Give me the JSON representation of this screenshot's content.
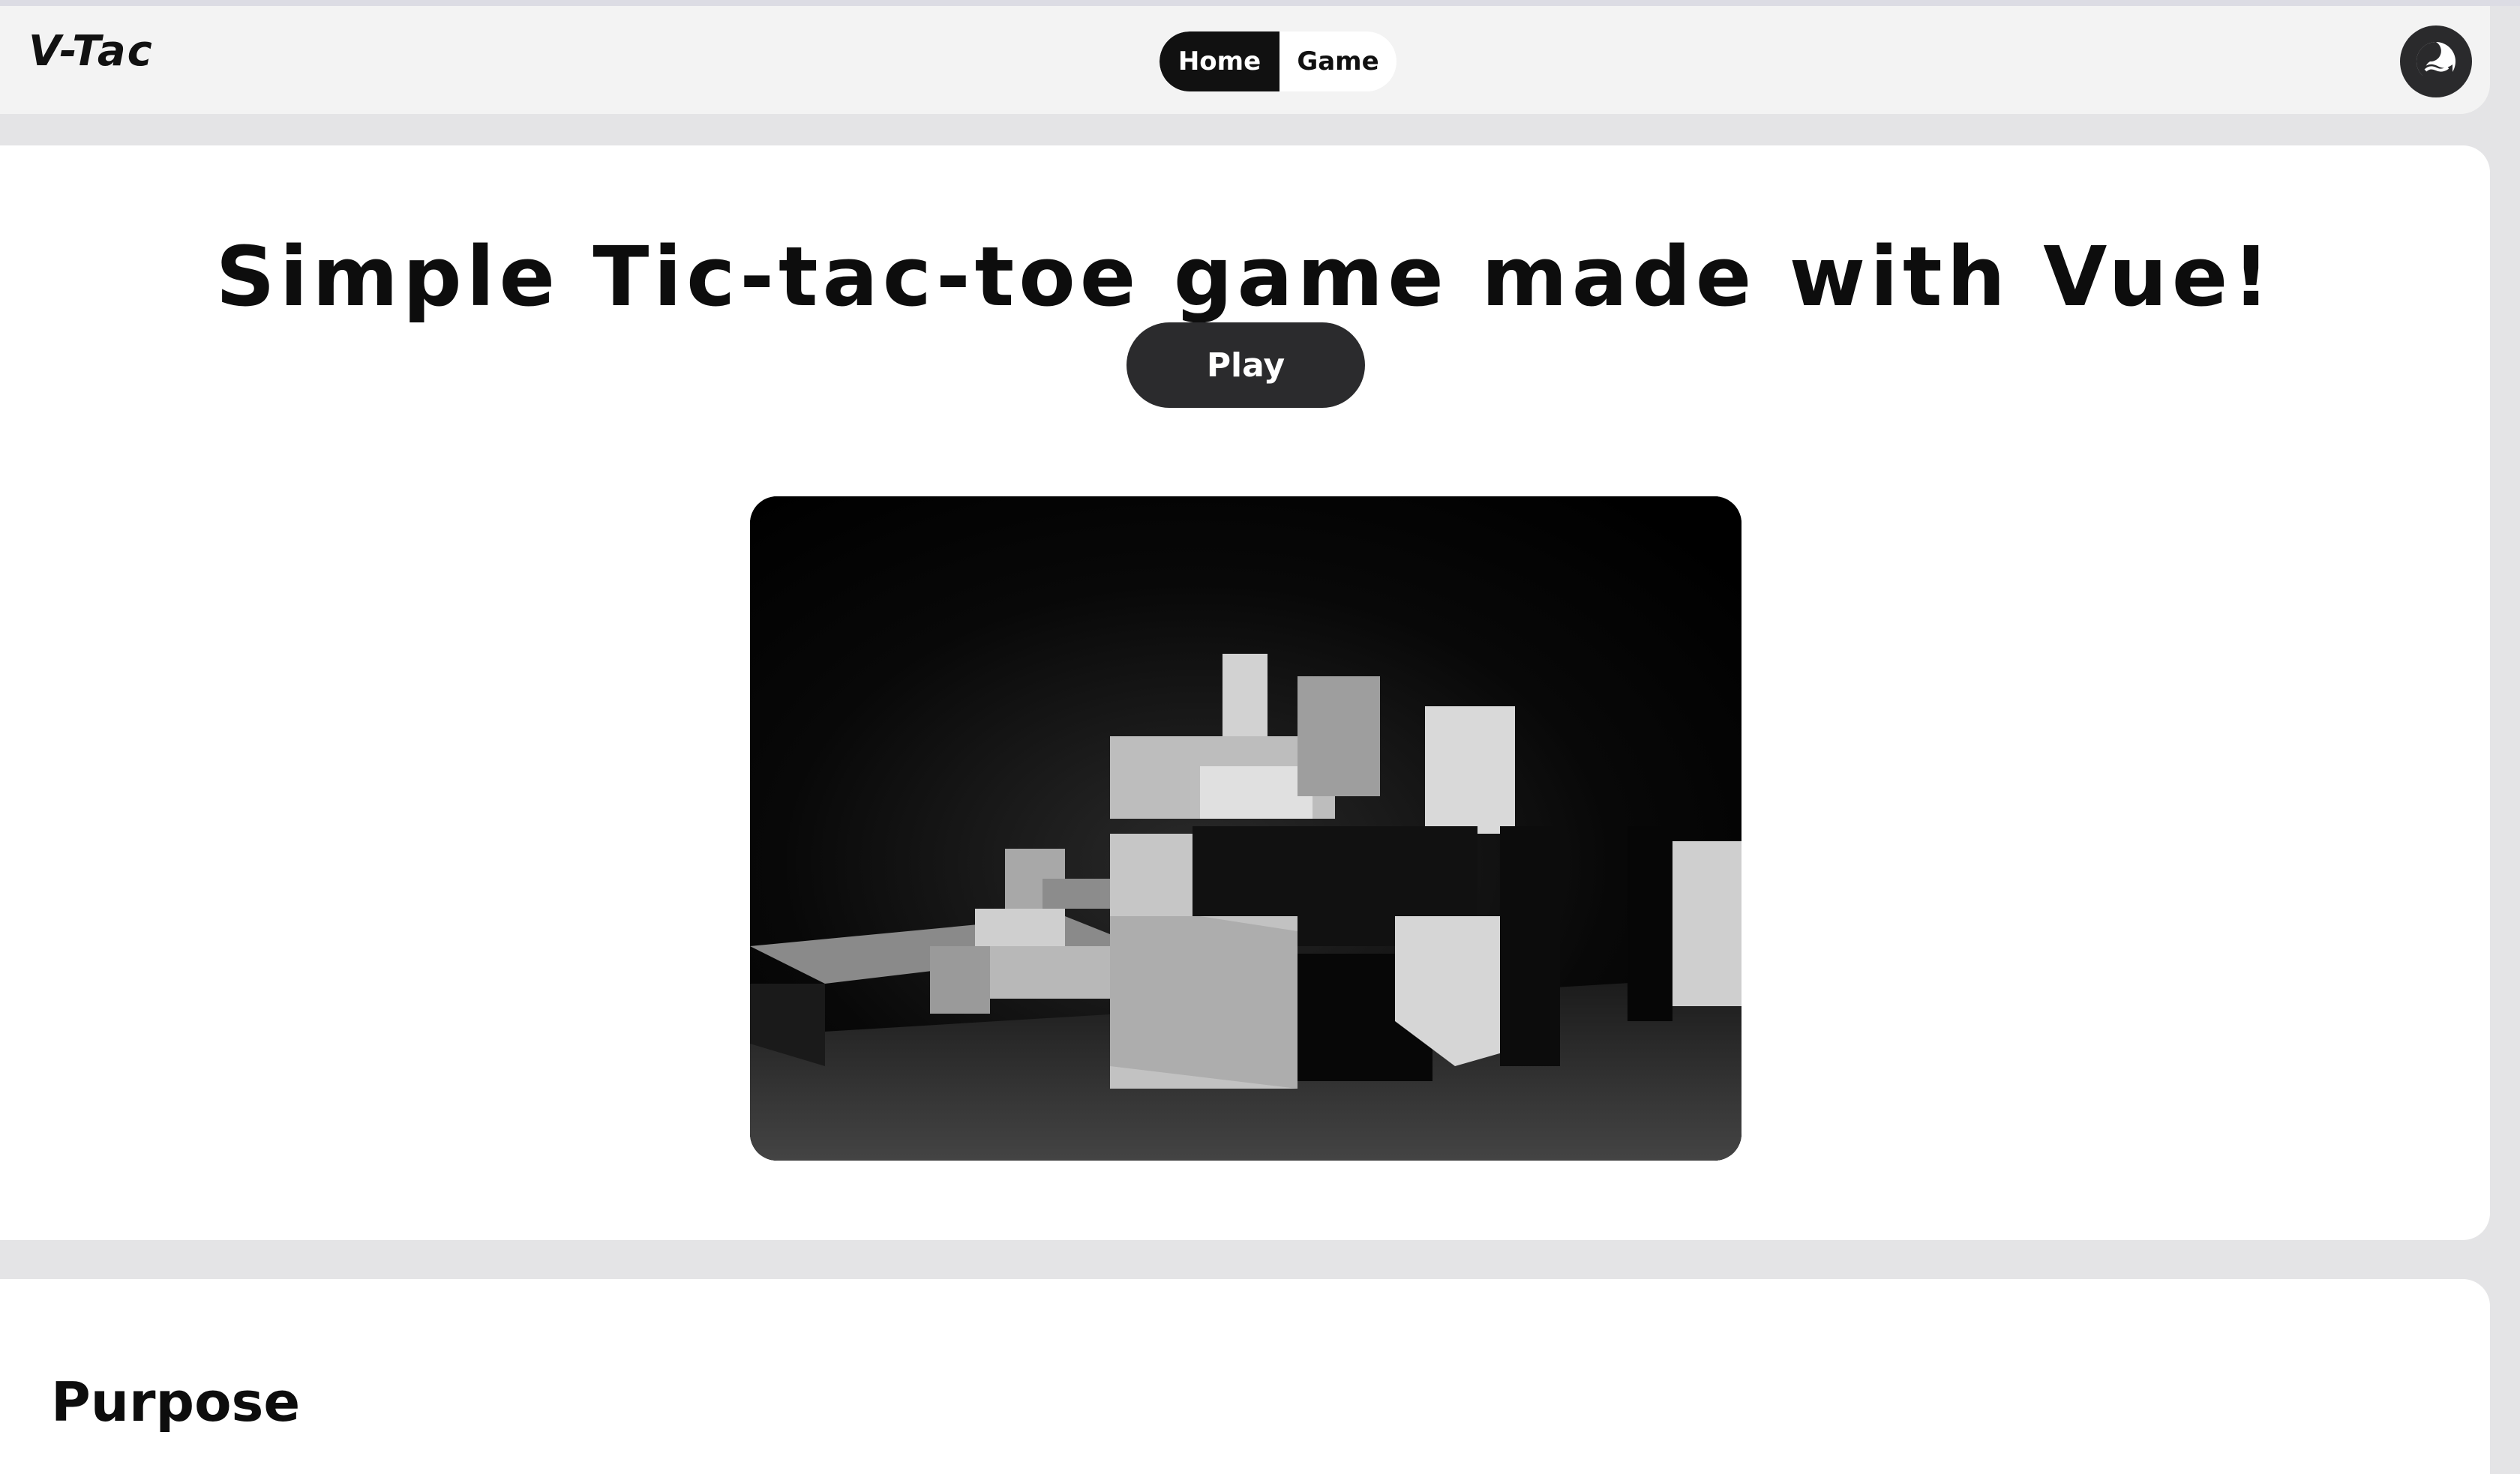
{
  "nav": {
    "brand": "V-Tac",
    "tabs": [
      {
        "label": "Home",
        "active": true
      },
      {
        "label": "Game",
        "active": false
      }
    ],
    "theme_toggle_icon": "theme-toggle-icon"
  },
  "hero": {
    "title": "Simple Tic-tac-toe game made with Vue!",
    "play_label": "Play",
    "image_icon": "abstract-blocks-image"
  },
  "purpose": {
    "title": "Purpose"
  },
  "colors": {
    "background": "#e4e4e6",
    "card": "#ffffff",
    "navbar": "#f3f3f3",
    "accent_dark": "#111111",
    "button": "#2b2b2d"
  }
}
